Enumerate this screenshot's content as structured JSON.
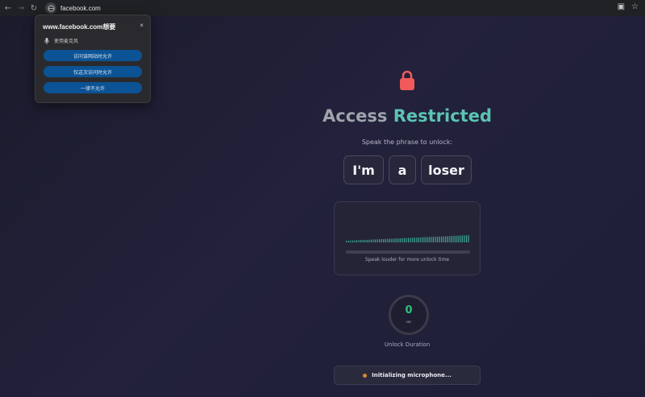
{
  "browser": {
    "url": "facebook.com"
  },
  "permission_popup": {
    "title": "www.facebook.com想要",
    "permission_label": "使用麦克风",
    "buttons": [
      {
        "label": "访问该网站时允许"
      },
      {
        "label": "仅这次访问时允许"
      },
      {
        "label": "一律不允许"
      }
    ],
    "close_symbol": "×"
  },
  "page": {
    "title_part1": "Access",
    "title_part2": "Restricted",
    "subtitle": "Speak the phrase to unlock:",
    "phrase_words": [
      "I'm",
      "a",
      "loser"
    ],
    "volume_hint": "Speak louder for more unlock time",
    "timer_value": "0",
    "timer_unit": "sec",
    "timer_label": "Unlock Duration",
    "status_text": "Initializing microphone...",
    "colors": {
      "accent_teal": "#5bc4b3",
      "lock_red": "#f05a5a",
      "timer_green": "#27c47a",
      "status_orange": "#d48b36",
      "perm_button_blue": "#0b5394"
    }
  }
}
